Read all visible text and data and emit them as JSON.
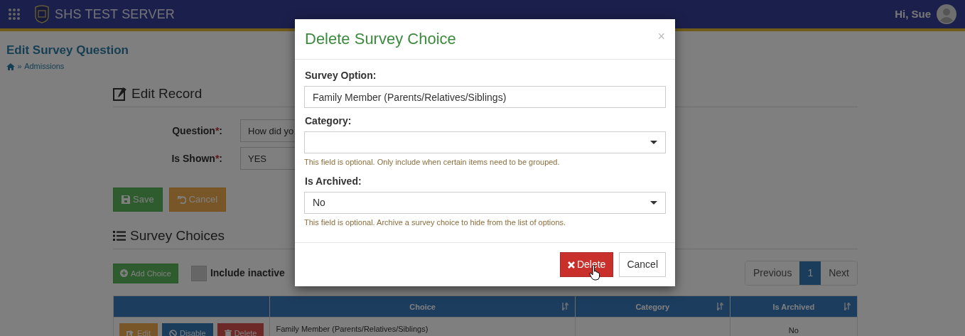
{
  "navbar": {
    "title": "SHS TEST SERVER",
    "greeting": "Hi, Sue"
  },
  "page": {
    "title": "Edit Survey Question",
    "breadcrumb": "Admissions",
    "separator": "»"
  },
  "edit_record": {
    "heading": "Edit Record",
    "fields": [
      {
        "label": "Question",
        "required_mark": "*",
        "label_end": ":",
        "value": "How did yo"
      },
      {
        "label": "Is Shown",
        "required_mark": "*",
        "label_end": ":",
        "value": "YES"
      }
    ],
    "buttons": [
      {
        "kind": "save",
        "label": "Save"
      },
      {
        "kind": "cancel",
        "label": "Cancel"
      }
    ]
  },
  "survey_choices": {
    "heading": "Survey Choices",
    "add_button": "Add Choice",
    "include_inactive": {
      "label": "Include inactive",
      "checked": false
    },
    "pagination": [
      {
        "label": "Previous",
        "selected": false
      },
      {
        "label": "1",
        "selected": true
      },
      {
        "label": "Next",
        "selected": false
      }
    ],
    "columns": [
      {
        "label": "Choice"
      },
      {
        "label": "Category"
      },
      {
        "label": "Is Archived"
      }
    ],
    "rows": [
      {
        "actions": [
          {
            "kind": "edit",
            "label": "Edit"
          },
          {
            "kind": "disable",
            "label": "Disable"
          },
          {
            "kind": "delete",
            "label": "Delete"
          }
        ],
        "choice": "Family Member (Parents/Relatives/Siblings)",
        "is_archived": "No"
      }
    ]
  },
  "modal": {
    "title": "Delete Survey Choice",
    "close": "×",
    "fields": [
      {
        "kind": "text",
        "label": "Survey Option:",
        "value": "Family Member (Parents/Relatives/Siblings)"
      },
      {
        "kind": "select",
        "label": "Category:",
        "help": "This field is optional. Only include when certain items need to be grouped."
      },
      {
        "kind": "select",
        "label": "Is Archived:",
        "value": "No",
        "help": "This field is optional. Archive a survey choice to hide from the list of options."
      }
    ],
    "buttons": [
      {
        "kind": "delete",
        "label": "Delete"
      },
      {
        "kind": "cancel",
        "label": "Cancel"
      }
    ]
  }
}
